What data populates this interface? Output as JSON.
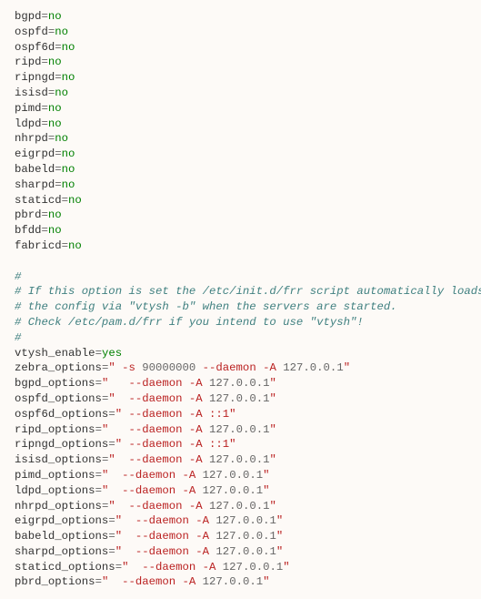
{
  "daemons": [
    {
      "name": "bgpd",
      "val": "no"
    },
    {
      "name": "ospfd",
      "val": "no"
    },
    {
      "name": "ospf6d",
      "val": "no"
    },
    {
      "name": "ripd",
      "val": "no"
    },
    {
      "name": "ripngd",
      "val": "no"
    },
    {
      "name": "isisd",
      "val": "no"
    },
    {
      "name": "pimd",
      "val": "no"
    },
    {
      "name": "ldpd",
      "val": "no"
    },
    {
      "name": "nhrpd",
      "val": "no"
    },
    {
      "name": "eigrpd",
      "val": "no"
    },
    {
      "name": "babeld",
      "val": "no"
    },
    {
      "name": "sharpd",
      "val": "no"
    },
    {
      "name": "staticd",
      "val": "no"
    },
    {
      "name": "pbrd",
      "val": "no"
    },
    {
      "name": "bfdd",
      "val": "no"
    },
    {
      "name": "fabricd",
      "val": "no"
    }
  ],
  "comments": [
    "#",
    "# If this option is set the /etc/init.d/frr script automatically loads",
    "# the config via \"vtysh -b\" when the servers are started.",
    "# Check /etc/pam.d/frr if you intend to use \"vtysh\"!",
    "#"
  ],
  "vtysh_enable": {
    "name": "vtysh_enable",
    "val": "yes"
  },
  "options": [
    {
      "name": "zebra_options",
      "pad": " ",
      "pre": "-s ",
      "number": "90000000",
      "mid": " --daemon -A ",
      "addr": "127.0.0.1"
    },
    {
      "name": "bgpd_options",
      "pad": "   ",
      "pre": "",
      "number": "",
      "mid": "--daemon -A ",
      "addr": "127.0.0.1"
    },
    {
      "name": "ospfd_options",
      "pad": "  ",
      "pre": "",
      "number": "",
      "mid": "--daemon -A ",
      "addr": "127.0.0.1"
    },
    {
      "name": "ospf6d_options",
      "pad": " ",
      "pre": "",
      "number": "",
      "mid": "--daemon -A ",
      "addr": "::1"
    },
    {
      "name": "ripd_options",
      "pad": "   ",
      "pre": "",
      "number": "",
      "mid": "--daemon -A ",
      "addr": "127.0.0.1"
    },
    {
      "name": "ripngd_options",
      "pad": " ",
      "pre": "",
      "number": "",
      "mid": "--daemon -A ",
      "addr": "::1"
    },
    {
      "name": "isisd_options",
      "pad": "  ",
      "pre": "",
      "number": "",
      "mid": "--daemon -A ",
      "addr": "127.0.0.1"
    },
    {
      "name": "pimd_options",
      "pad": "  ",
      "pre": "",
      "number": "",
      "mid": "--daemon -A ",
      "addr": "127.0.0.1"
    },
    {
      "name": "ldpd_options",
      "pad": "  ",
      "pre": "",
      "number": "",
      "mid": "--daemon -A ",
      "addr": "127.0.0.1"
    },
    {
      "name": "nhrpd_options",
      "pad": "  ",
      "pre": "",
      "number": "",
      "mid": "--daemon -A ",
      "addr": "127.0.0.1"
    },
    {
      "name": "eigrpd_options",
      "pad": "  ",
      "pre": "",
      "number": "",
      "mid": "--daemon -A ",
      "addr": "127.0.0.1"
    },
    {
      "name": "babeld_options",
      "pad": "  ",
      "pre": "",
      "number": "",
      "mid": "--daemon -A ",
      "addr": "127.0.0.1"
    },
    {
      "name": "sharpd_options",
      "pad": "  ",
      "pre": "",
      "number": "",
      "mid": "--daemon -A ",
      "addr": "127.0.0.1"
    },
    {
      "name": "staticd_options",
      "pad": "  ",
      "pre": "",
      "number": "",
      "mid": "--daemon -A ",
      "addr": "127.0.0.1"
    },
    {
      "name": "pbrd_options",
      "pad": "  ",
      "pre": "",
      "number": "",
      "mid": "--daemon -A ",
      "addr": "127.0.0.1"
    }
  ]
}
